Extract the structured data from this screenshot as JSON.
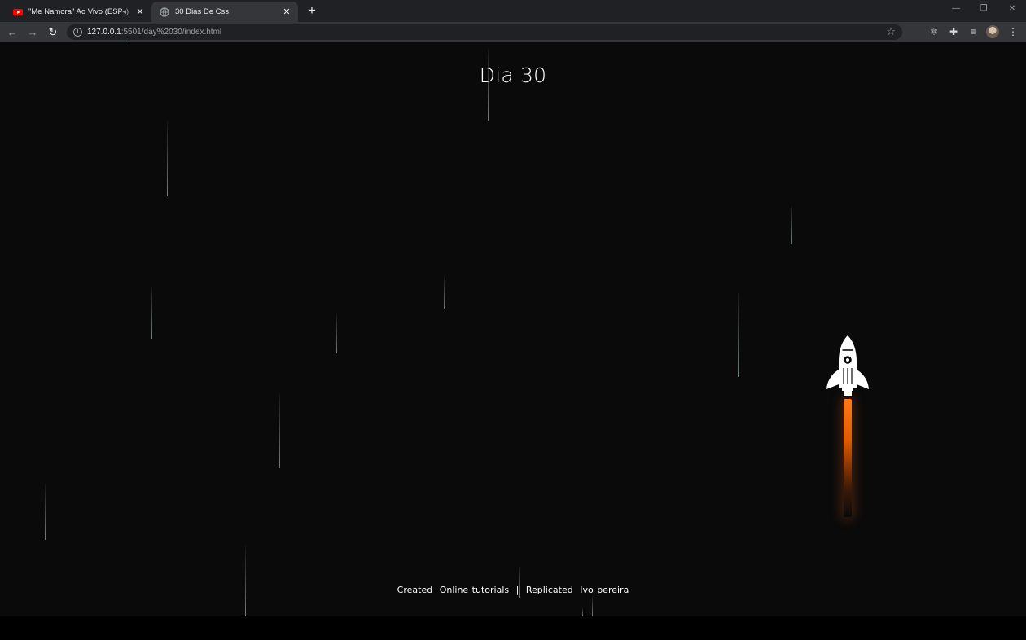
{
  "browser": {
    "tabs": [
      {
        "title": "\"Me Namora\" Ao Vivo (ESPE",
        "audio": true,
        "active": false
      },
      {
        "title": "30 Dias De Css",
        "active": true
      }
    ],
    "url": {
      "host": "127.0.0.1",
      "path": ":5501/day%2030/index.html"
    }
  },
  "page": {
    "heading": "Dia 30",
    "footer": {
      "created": "Created",
      "author1": "Online tutorials",
      "separator": "|",
      "replicated": "Replicated",
      "author2": "Ivo pereira"
    }
  },
  "colors": {
    "background": "#0a0a0b",
    "flame": "#ff7a18",
    "rocket": "#ffffff"
  }
}
